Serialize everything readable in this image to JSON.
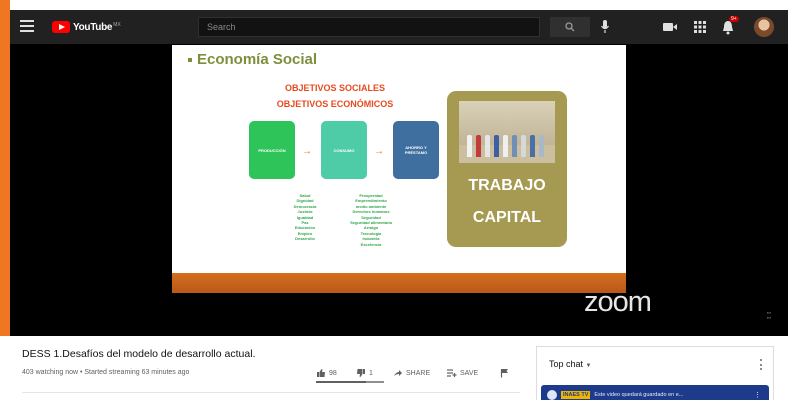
{
  "header": {
    "logo_text": "YouTube",
    "logo_country": "MX",
    "search_placeholder": "Search",
    "notification_count": "9+"
  },
  "slide": {
    "title": "Economía Social",
    "objective_1": "OBJETIVOS SOCIALES",
    "objective_2": "OBJETIVOS ECONÓMICOS",
    "flow_boxes": [
      "PRODUCCIÓN",
      "CONSUMO",
      "AHORRO Y PRÉSTAMO"
    ],
    "social_values": [
      "Salud",
      "Dignidad",
      "Democracia",
      "Justicia",
      "Igualdad",
      "Paz",
      "Educación",
      "Empleo",
      "Desarrollo"
    ],
    "economic_values": [
      "Prosperidad",
      "Emprendimiento",
      "medio ambiente",
      "Derechos humanos",
      "Seguridad",
      "Seguridad alimentaria",
      "Arraigo",
      "Tecnología",
      "Industria",
      "Excelencia"
    ],
    "trabajo": "TRABAJO",
    "capital": "CAPITAL",
    "zoom_watermark": "zoom"
  },
  "video": {
    "title": "DESS 1.Desafíos del modelo de desarrollo actual.",
    "meta": "403 watching now • Started streaming 63 minutes ago",
    "likes": "98",
    "dislikes": "1",
    "share_label": "SHARE",
    "save_label": "SAVE"
  },
  "chat": {
    "header": "Top chat",
    "pinned_channel": "INAES TV",
    "pinned_text": "Este video quedará guardado en e..."
  },
  "colors": {
    "accent_orange": "#f07722",
    "youtube_red": "#ff0000",
    "topbar_bg": "#212121",
    "card_olive": "#a69a52",
    "pinned_blue": "#1e3a8a"
  },
  "icons": {
    "menu": "hamburger-menu-icon",
    "search": "search-icon",
    "mic": "microphone-icon",
    "create": "create-video-icon",
    "apps": "apps-grid-icon",
    "notifications": "bell-icon",
    "like": "thumbs-up-icon",
    "dislike": "thumbs-down-icon",
    "share": "share-arrow-icon",
    "save": "playlist-add-icon",
    "flag": "flag-icon"
  }
}
